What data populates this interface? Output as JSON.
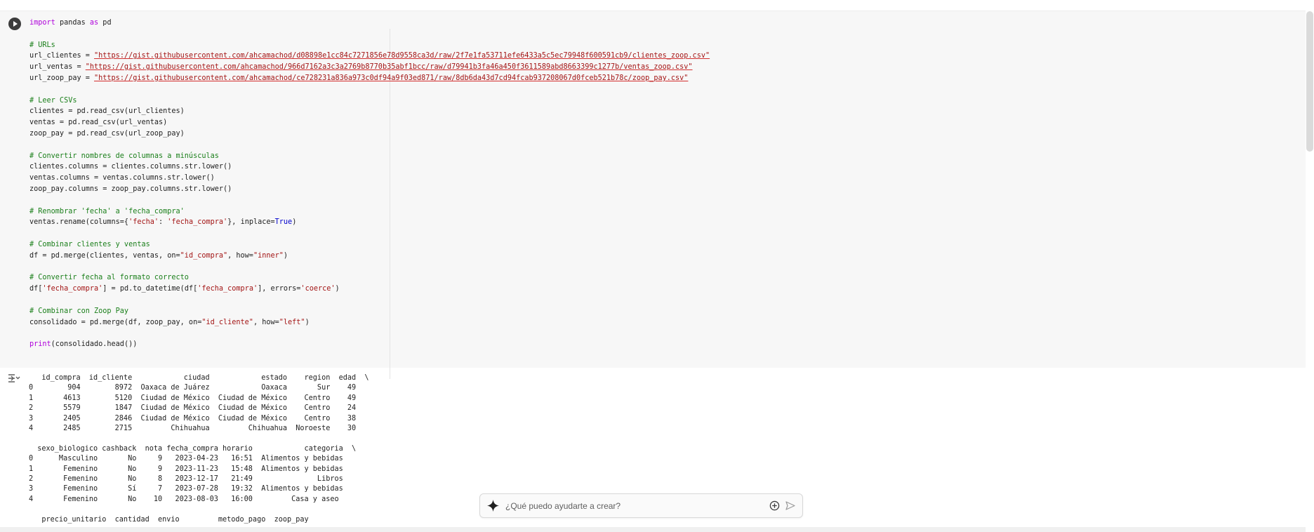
{
  "cell": {
    "lines": {
      "l1_import": "import",
      "l1_rest": " pandas ",
      "l1_as": "as",
      "l1_pd": " pd",
      "c_urls": "# URLs",
      "url_clientes_var": "url_clientes = ",
      "url_clientes": "\"https://gist.githubusercontent.com/ahcamachod/d08898e1cc84c7271856e78d9558ca3d/raw/2f7e1fa53711efe6433a5c5ec79948f600591cb9/clientes_zoop.csv\"",
      "url_ventas_var": "url_ventas = ",
      "url_ventas": "\"https://gist.githubusercontent.com/ahcamachod/966d7162a3c3a2769b8770b35abf1bcc/raw/d79941b3fa46a450f3611589abd8663399c1277b/ventas_zoop.csv\"",
      "url_zoop_pay_var": "url_zoop_pay = ",
      "url_zoop_pay": "\"https://gist.githubusercontent.com/ahcamachod/ce728231a836a973c0df94a9f03ed871/raw/8db6da43d7cd94fcab937208067d0fceb521b78c/zoop_pay.csv\"",
      "c_leer": "# Leer CSVs",
      "read1": "clientes = pd.read_csv(url_clientes)",
      "read2": "ventas = pd.read_csv(url_ventas)",
      "read3": "zoop_pay = pd.read_csv(url_zoop_pay)",
      "c_min": "# Convertir nombres de columnas a minúsculas",
      "low1": "clientes.columns = clientes.columns.str.lower()",
      "low2": "ventas.columns = ventas.columns.str.lower()",
      "low3": "zoop_pay.columns = zoop_pay.columns.str.lower()",
      "c_ren": "# Renombrar 'fecha' a 'fecha_compra'",
      "ren_a": "ventas.rename(columns={",
      "ren_s1": "'fecha'",
      "ren_b": ": ",
      "ren_s2": "'fecha_compra'",
      "ren_c": "}, inplace=",
      "ren_true": "True",
      "ren_d": ")",
      "c_comb": "# Combinar clientes y ventas",
      "m1_a": "df = pd.merge(clientes, ventas, on=",
      "m1_s1": "\"id_compra\"",
      "m1_b": ", how=",
      "m1_s2": "\"inner\"",
      "m1_c": ")",
      "c_fecha": "# Convertir fecha al formato correcto",
      "d_a": "df[",
      "d_s1": "'fecha_compra'",
      "d_b": "] = pd.to_datetime(df[",
      "d_s2": "'fecha_compra'",
      "d_c": "], errors=",
      "d_s3": "'coerce'",
      "d_d": ")",
      "c_zoop": "# Combinar con Zoop Pay",
      "m2_a": "consolidado = pd.merge(df, zoop_pay, on=",
      "m2_s1": "\"id_cliente\"",
      "m2_b": ", how=",
      "m2_s2": "\"left\"",
      "m2_c": ")",
      "p_print": "print",
      "p_rest": "(consolidado.head())"
    }
  },
  "output": {
    "text": "   id_compra  id_cliente            ciudad            estado    region  edad  \\\n0        904        8972  Oaxaca de Juárez            Oaxaca       Sur    49   \n1       4613        5120  Ciudad de México  Ciudad de México    Centro    49   \n2       5579        1847  Ciudad de México  Ciudad de México    Centro    24   \n3       2405        2846  Ciudad de México  Ciudad de México    Centro    38   \n4       2485        2715         Chihuahua         Chihuahua  Noroeste    30   \n\n  sexo_biologico cashback  nota fecha_compra horario            categoria  \\\n0      Masculino       No     9   2023-04-23   16:51  Alimentos y bebidas   \n1       Femenino       No     9   2023-11-23   15:48  Alimentos y bebidas   \n2       Femenino       No     8   2023-12-17   21:49               Libros   \n3       Femenino       Sí     7   2023-07-28   19:32  Alimentos y bebidas   \n4       Femenino       No    10   2023-08-03   16:00         Casa y aseo   \n\n   precio_unitario  cantidad  envio         metodo_pago  zoop_pay"
  },
  "chat": {
    "placeholder": "¿Qué puedo ayudarte a crear?"
  },
  "icons": {
    "run": "play-icon",
    "output": "output-toggle-icon",
    "spark": "sparkle-icon",
    "add": "plus-circle-icon",
    "send": "send-icon"
  },
  "colors": {
    "keyword": "#af00db",
    "comment": "#1a7f1a",
    "string": "#a31515",
    "builtin": "#0000cc"
  }
}
